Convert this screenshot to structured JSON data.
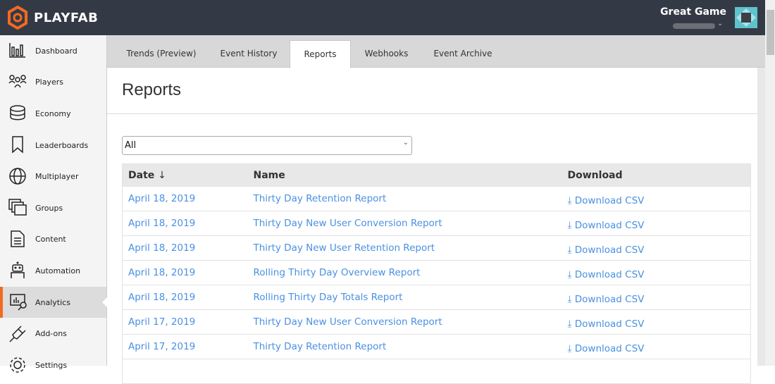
{
  "header": {
    "brand": "PLAYFAB",
    "game_title": "Great Game"
  },
  "sidebar": {
    "items": [
      {
        "label": "Dashboard",
        "icon": "bar-chart-icon"
      },
      {
        "label": "Players",
        "icon": "players-icon"
      },
      {
        "label": "Economy",
        "icon": "coins-icon"
      },
      {
        "label": "Leaderboards",
        "icon": "bookmark-icon"
      },
      {
        "label": "Multiplayer",
        "icon": "globe-icon"
      },
      {
        "label": "Groups",
        "icon": "groups-icon"
      },
      {
        "label": "Content",
        "icon": "document-icon"
      },
      {
        "label": "Automation",
        "icon": "robot-icon"
      },
      {
        "label": "Analytics",
        "icon": "analytics-icon",
        "active": true
      },
      {
        "label": "Add-ons",
        "icon": "plug-icon"
      },
      {
        "label": "Settings",
        "icon": "gear-icon"
      }
    ]
  },
  "tabs": [
    "Trends (Preview)",
    "Event History",
    "Reports",
    "Webhooks",
    "Event Archive"
  ],
  "active_tab": "Reports",
  "page_title": "Reports",
  "filter": {
    "selected": "All"
  },
  "table": {
    "headers": {
      "date": "Date",
      "sort": "↓",
      "name": "Name",
      "download": "Download"
    },
    "rows": [
      {
        "date": "April 18, 2019",
        "name": "Thirty Day Retention Report",
        "download": "Download CSV"
      },
      {
        "date": "April 18, 2019",
        "name": "Thirty Day New User Conversion Report",
        "download": "Download CSV"
      },
      {
        "date": "April 18, 2019",
        "name": "Thirty Day New User Retention Report",
        "download": "Download CSV"
      },
      {
        "date": "April 18, 2019",
        "name": "Rolling Thirty Day Overview Report",
        "download": "Download CSV"
      },
      {
        "date": "April 18, 2019",
        "name": "Rolling Thirty Day Totals Report",
        "download": "Download CSV"
      },
      {
        "date": "April 17, 2019",
        "name": "Thirty Day New User Conversion Report",
        "download": "Download CSV"
      },
      {
        "date": "April 17, 2019",
        "name": "Thirty Day Retention Report",
        "download": "Download CSV"
      },
      {
        "date": "",
        "name": "",
        "download": ""
      }
    ]
  },
  "colors": {
    "accent": "#f26a21",
    "link": "#4a90e2",
    "header_bg": "#343a45"
  }
}
